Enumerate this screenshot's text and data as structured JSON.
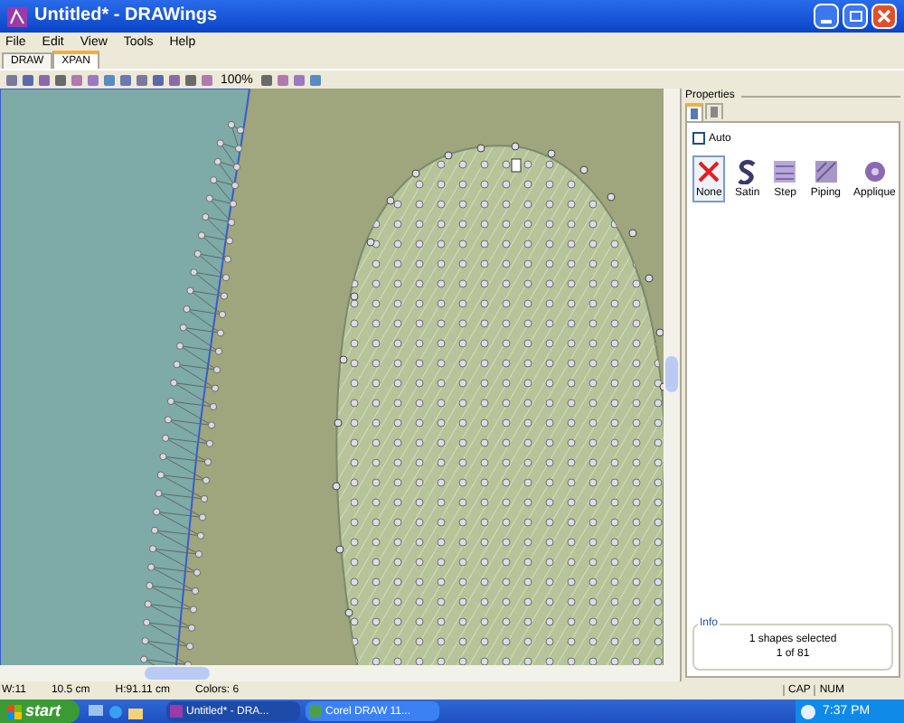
{
  "window": {
    "title": "Untitled* - DRAWings"
  },
  "menu": [
    "File",
    "Edit",
    "View",
    "Tools",
    "Help"
  ],
  "tabs": [
    {
      "label": "DRAW",
      "selected": false
    },
    {
      "label": "XPAN",
      "selected": true
    }
  ],
  "toolbar": {
    "zoom": "100%"
  },
  "properties": {
    "title": "Properties",
    "panel_tabs": [
      {
        "selected": true
      },
      {
        "selected": false
      }
    ],
    "auto": {
      "label": "Auto",
      "checked": false
    },
    "stitch_types": [
      {
        "kind": "none",
        "label": "None",
        "selected": true
      },
      {
        "kind": "satin",
        "label": "Satin",
        "selected": false
      },
      {
        "kind": "step",
        "label": "Step",
        "selected": false
      },
      {
        "kind": "piping",
        "label": "Piping",
        "selected": false
      },
      {
        "kind": "applique",
        "label": "Applique",
        "selected": false
      }
    ],
    "info": {
      "title": "Info",
      "lines": [
        "1 shapes selected",
        "1 of 81"
      ]
    }
  },
  "status_bar": {
    "fields": [
      "W:11",
      "10.5 cm",
      "H:91.11 cm",
      "Colors: 6"
    ],
    "indicators": [
      "CAP",
      "NUM"
    ]
  },
  "taskbar": {
    "start": "start",
    "tasks": [
      {
        "label": "Untitled* - DRA...",
        "selected": true
      },
      {
        "label": "Corel DRAW 11...",
        "selected": false
      }
    ],
    "clock": "7:37 PM"
  }
}
